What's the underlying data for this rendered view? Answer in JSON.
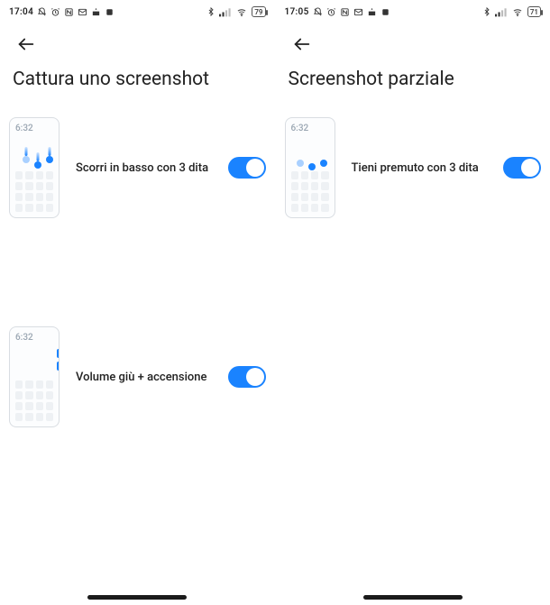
{
  "left": {
    "statusbar": {
      "time": "17:04",
      "battery": "79"
    },
    "title": "Cattura uno screenshot",
    "mock_time": "6:32",
    "options": [
      {
        "label": "Scorri in basso con 3 dita",
        "on": true,
        "kind": "swipe3"
      },
      {
        "label": "Volume giù + accensione",
        "on": true,
        "kind": "volpower"
      }
    ]
  },
  "right": {
    "statusbar": {
      "time": "17:05",
      "battery": "71"
    },
    "title": "Screenshot parziale",
    "mock_time": "6:32",
    "options": [
      {
        "label": "Tieni premuto con 3 dita",
        "on": true,
        "kind": "hold3"
      }
    ]
  }
}
